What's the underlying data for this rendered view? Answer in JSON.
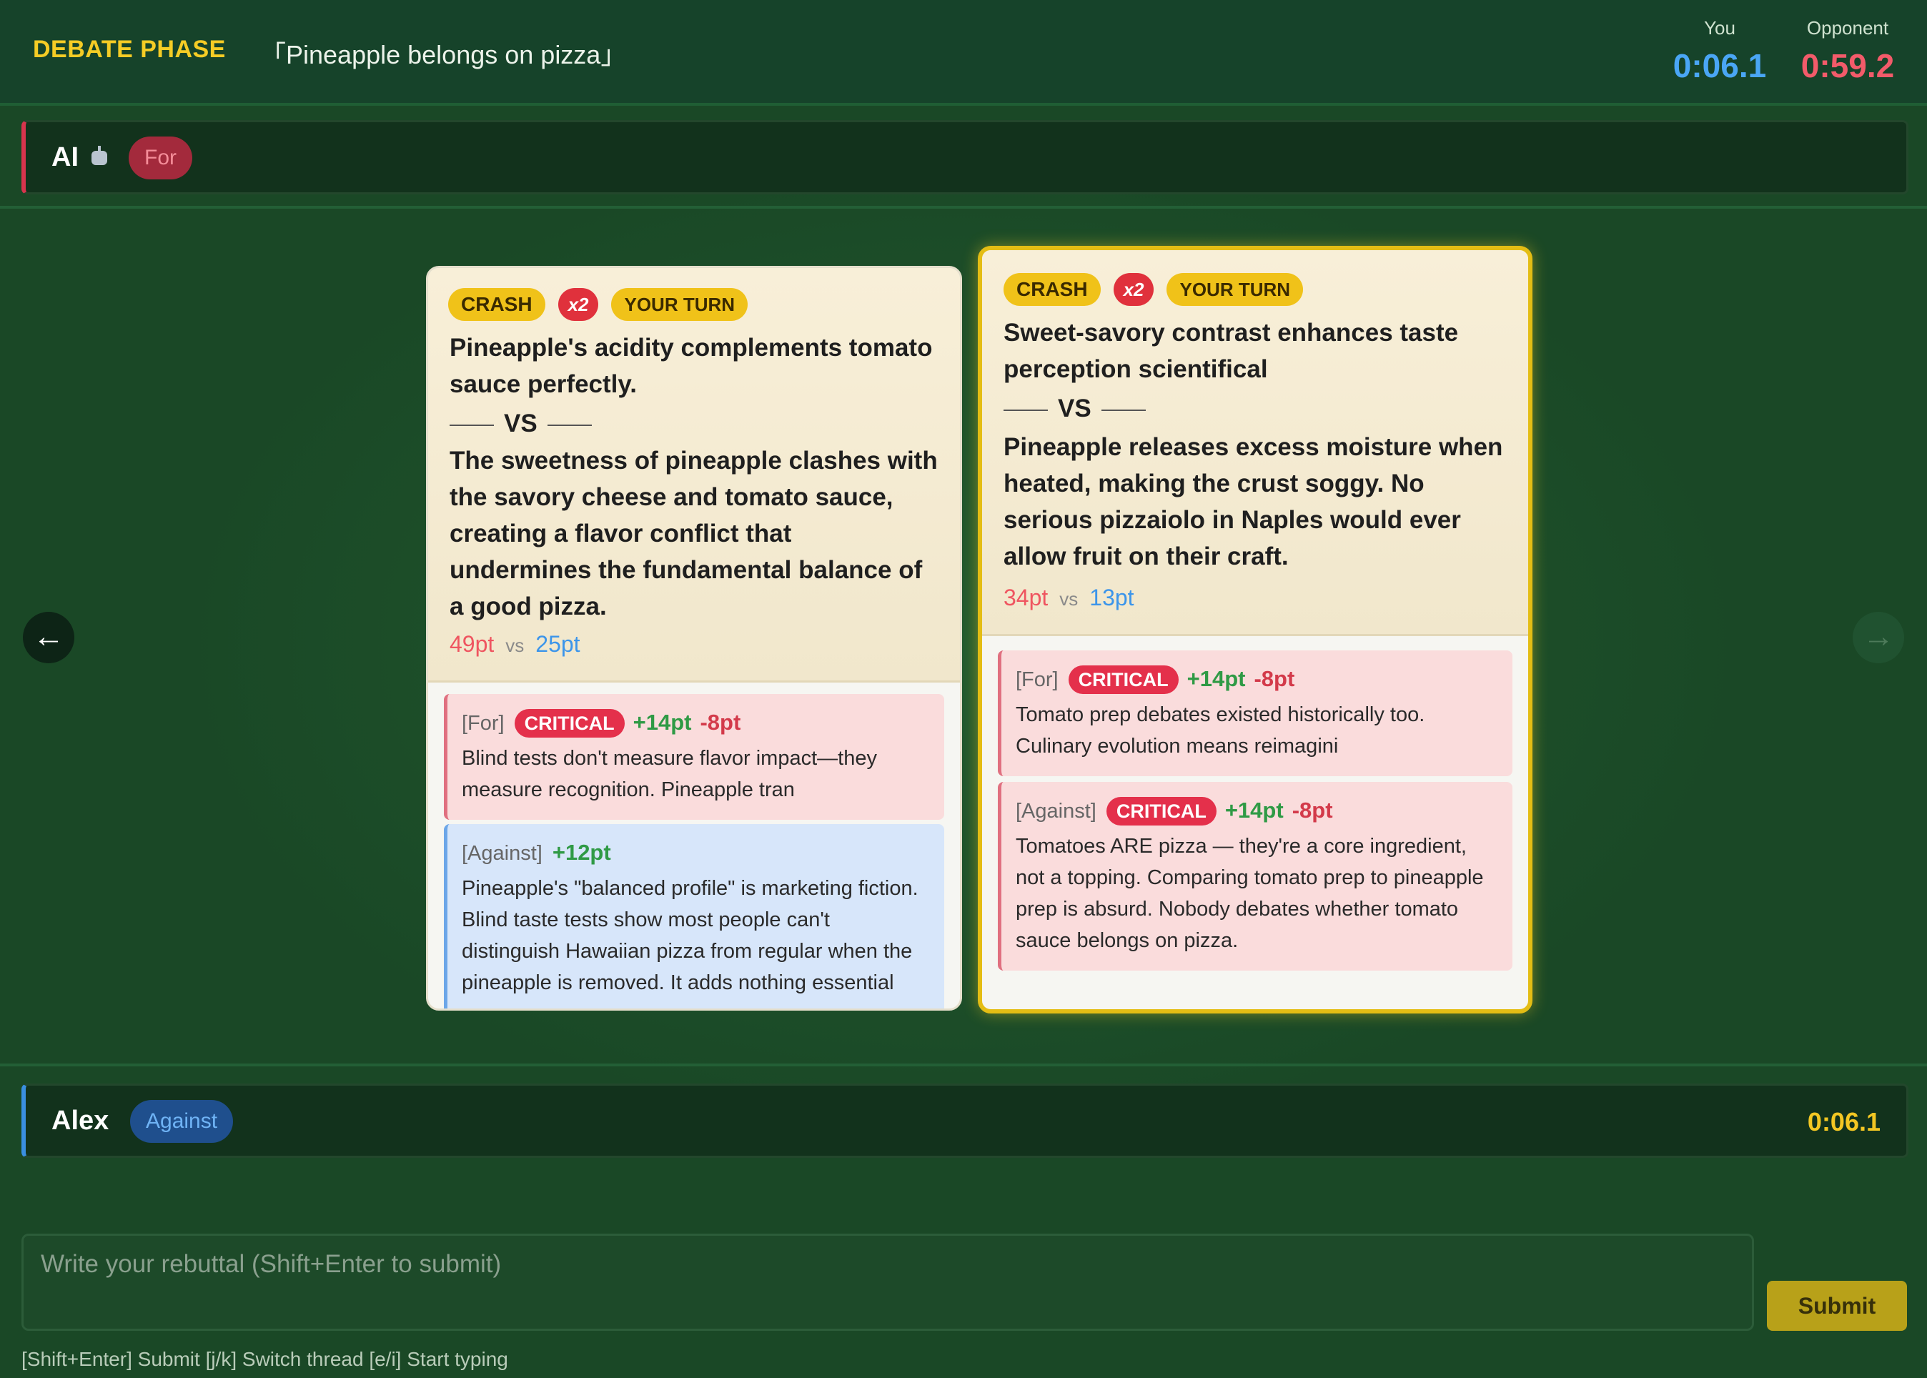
{
  "header": {
    "phase": "DEBATE PHASE",
    "topic": "「Pineapple belongs on pizza」",
    "you_label": "You",
    "you_time": "0:06.1",
    "opponent_label": "Opponent",
    "opponent_time": "0:59.2"
  },
  "opponent_bar": {
    "name": "AI",
    "side": "For"
  },
  "player_bar": {
    "name": "Alex",
    "side": "Against",
    "time": "0:06.1"
  },
  "nav": {
    "left": "←",
    "right": "→"
  },
  "cards": [
    {
      "badges": {
        "crash": "CRASH",
        "multiplier": "x2",
        "turn": "YOUR TURN"
      },
      "claim_for": "Pineapple's acidity complements tomato sauce perfectly.",
      "vs": "VS",
      "claim_against": "The sweetness of pineapple clashes with the savory cheese and tomato sauce, creating a flavor conflict that undermines the fundamental balance of a good pizza.",
      "score_for": "49pt",
      "score_vs": "vs",
      "score_against": "25pt",
      "comments": [
        {
          "side": "[For]",
          "tag": "CRITICAL",
          "plus": "+14pt",
          "minus": "-8pt",
          "text": "Blind tests don't measure flavor impact—they measure recognition. Pineapple tran"
        },
        {
          "side": "[Against]",
          "plus": "+12pt",
          "text": "Pineapple's \"balanced profile\" is marketing fiction. Blind taste tests show most people can't distinguish Hawaiian pizza from regular when the pineapple is removed. It adds nothing essential"
        }
      ]
    },
    {
      "badges": {
        "crash": "CRASH",
        "multiplier": "x2",
        "turn": "YOUR TURN"
      },
      "claim_for": "Sweet-savory contrast enhances taste perception scientifical",
      "vs": "VS",
      "claim_against": "Pineapple releases excess moisture when heated, making the crust soggy. No serious pizzaiolo in Naples would ever allow fruit on their craft.",
      "score_for": "34pt",
      "score_vs": "vs",
      "score_against": "13pt",
      "comments": [
        {
          "side": "[For]",
          "tag": "CRITICAL",
          "plus": "+14pt",
          "minus": "-8pt",
          "text": "Tomato prep debates existed historically too. Culinary evolution means reimagini"
        },
        {
          "side": "[Against]",
          "tag": "CRITICAL",
          "plus": "+14pt",
          "minus": "-8pt",
          "text": "Tomatoes ARE pizza — they're a core ingredient, not a topping. Comparing tomato prep to pineapple prep is absurd. Nobody debates whether tomato sauce belongs on pizza."
        }
      ]
    }
  ],
  "input": {
    "placeholder": "Write your rebuttal (Shift+Enter to submit)",
    "value": "",
    "submit_label": "Submit"
  },
  "hints": "[Shift+Enter] Submit [j/k] Switch thread [e/i] Start typing",
  "colors": {
    "phase": "#f5cc25",
    "you_timer": "#4aa6f5",
    "opponent_timer": "#f35b6a",
    "for_accent": "#d8344d",
    "against_accent": "#3a8fe0",
    "active_card_border": "#e4bd14"
  }
}
